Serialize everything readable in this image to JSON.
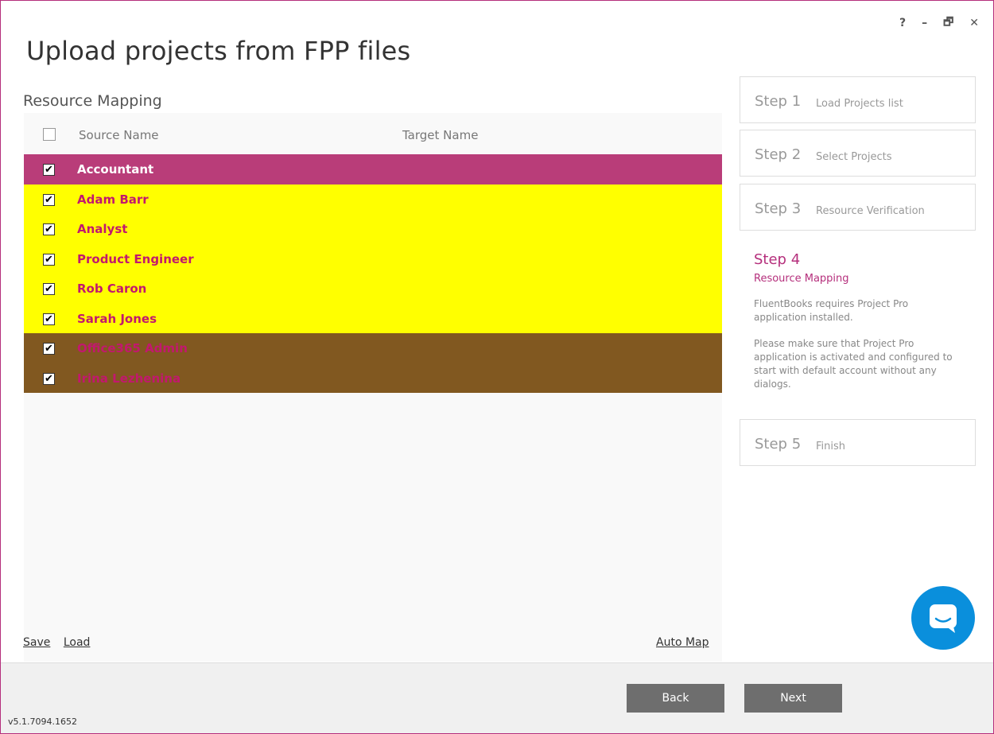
{
  "window": {
    "title": "Upload projects from FPP files",
    "controls": [
      "?",
      "–",
      "🗗",
      "✕"
    ]
  },
  "mapping": {
    "section_title": "Resource Mapping",
    "col_source": "Source Name",
    "col_target": "Target Name",
    "rows": [
      {
        "name": "Accountant",
        "checked": true,
        "color": "#b93d79"
      },
      {
        "name": "Adam Barr",
        "checked": true,
        "color": "#ffff00"
      },
      {
        "name": "Analyst",
        "checked": true,
        "color": "#ffff00"
      },
      {
        "name": "Product Engineer",
        "checked": true,
        "color": "#ffff00"
      },
      {
        "name": "Rob Caron",
        "checked": true,
        "color": "#ffff00"
      },
      {
        "name": "Sarah Jones",
        "checked": true,
        "color": "#ffff00"
      },
      {
        "name": "Office365 Admin",
        "checked": true,
        "color": "#815820"
      },
      {
        "name": "Irina Lezhenina",
        "checked": true,
        "color": "#815820"
      }
    ],
    "save_label": "Save",
    "load_label": "Load",
    "automap_label": "Auto Map"
  },
  "steps": {
    "s1": {
      "num": "Step 1",
      "label": "Load Projects list"
    },
    "s2": {
      "num": "Step 2",
      "label": "Select Projects"
    },
    "s3": {
      "num": "Step 3",
      "label": "Resource Verification"
    },
    "s4": {
      "num": "Step 4",
      "label": "Resource Mapping",
      "text1": "FluentBooks requires Project Pro application installed.",
      "text2": "Please make sure that Project Pro application is activated and configured to start with default account without any dialogs."
    },
    "s5": {
      "num": "Step 5",
      "label": "Finish"
    }
  },
  "buttons": {
    "back": "Back",
    "next": "Next"
  },
  "version": "v5.1.7094.1652",
  "colors": {
    "accent": "#b52f7c",
    "chat": "#0a8fdc"
  }
}
